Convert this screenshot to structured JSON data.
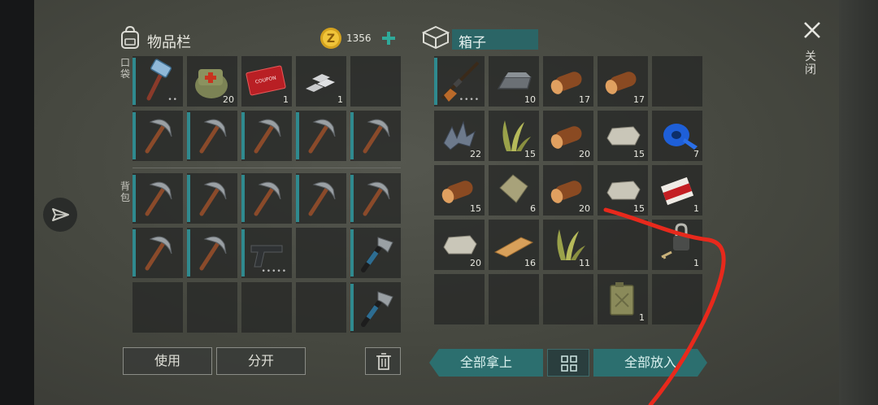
{
  "inventory": {
    "title": "物品栏",
    "pocket_label": "口袋",
    "backpack_label": "背包",
    "coins": "1356",
    "use_button": "使用",
    "split_button": "分开",
    "slots": [
      {
        "item": "hammer-icon",
        "count": "",
        "dots": "••",
        "indicator": true
      },
      {
        "item": "medkit-bag-icon",
        "count": "20",
        "dots": "",
        "indicator": false
      },
      {
        "item": "coupon-icon",
        "count": "1",
        "dots": "",
        "indicator": false,
        "coupon_text": "COMBAT TRADE COUPON"
      },
      {
        "item": "iron-ingots-icon",
        "count": "1",
        "dots": "",
        "indicator": false
      },
      {
        "item": "",
        "count": "",
        "dots": "",
        "indicator": false
      },
      {
        "item": "pickaxe-icon",
        "count": "",
        "dots": "",
        "indicator": true
      },
      {
        "item": "pickaxe-icon",
        "count": "",
        "dots": "",
        "indicator": true
      },
      {
        "item": "pickaxe-icon",
        "count": "",
        "dots": "",
        "indicator": true
      },
      {
        "item": "pickaxe-icon",
        "count": "",
        "dots": "",
        "indicator": true
      },
      {
        "item": "pickaxe-icon",
        "count": "",
        "dots": "",
        "indicator": true
      },
      {
        "item": "pickaxe-icon",
        "count": "",
        "dots": "",
        "indicator": true
      },
      {
        "item": "pickaxe-icon",
        "count": "",
        "dots": "",
        "indicator": true
      },
      {
        "item": "pickaxe-icon",
        "count": "",
        "dots": "",
        "indicator": true
      },
      {
        "item": "pickaxe-icon",
        "count": "",
        "dots": "",
        "indicator": true
      },
      {
        "item": "pickaxe-icon",
        "count": "",
        "dots": "",
        "indicator": true
      },
      {
        "item": "pickaxe-icon",
        "count": "",
        "dots": "",
        "indicator": true
      },
      {
        "item": "pickaxe-icon",
        "count": "",
        "dots": "",
        "indicator": true
      },
      {
        "item": "pistol-icon",
        "count": "",
        "dots": "•••••",
        "indicator": true
      },
      {
        "item": "",
        "count": "",
        "dots": "",
        "indicator": false
      },
      {
        "item": "hatchet-icon",
        "count": "",
        "dots": "",
        "indicator": true
      },
      {
        "item": "",
        "count": "",
        "dots": "",
        "indicator": false
      },
      {
        "item": "",
        "count": "",
        "dots": "",
        "indicator": false
      },
      {
        "item": "",
        "count": "",
        "dots": "",
        "indicator": false
      },
      {
        "item": "",
        "count": "",
        "dots": "",
        "indicator": false
      },
      {
        "item": "hatchet-icon",
        "count": "",
        "dots": "",
        "indicator": true
      }
    ]
  },
  "box": {
    "title": "箱子",
    "take_all_button": "全部拿上",
    "put_all_button": "全部放入",
    "slots": [
      {
        "item": "rifle-icon",
        "count": "",
        "dots": "••••",
        "indicator": true
      },
      {
        "item": "iron-ingot-icon",
        "count": "10"
      },
      {
        "item": "wood-log-icon",
        "count": "17"
      },
      {
        "item": "wood-log-icon",
        "count": "17"
      },
      {
        "item": "",
        "count": ""
      },
      {
        "item": "metal-scrap-icon",
        "count": "22"
      },
      {
        "item": "plant-fiber-icon",
        "count": "15"
      },
      {
        "item": "wood-log-icon",
        "count": "20"
      },
      {
        "item": "stone-icon",
        "count": "15"
      },
      {
        "item": "duct-tape-icon",
        "count": "7"
      },
      {
        "item": "wood-log-icon",
        "count": "15"
      },
      {
        "item": "cloth-icon",
        "count": "6"
      },
      {
        "item": "wood-log-icon",
        "count": "20"
      },
      {
        "item": "stone-icon",
        "count": "15"
      },
      {
        "item": "cigarettes-icon",
        "count": "1"
      },
      {
        "item": "stone-icon",
        "count": "20"
      },
      {
        "item": "plank-icon",
        "count": "16"
      },
      {
        "item": "plant-fiber-icon",
        "count": "11"
      },
      {
        "item": "",
        "count": ""
      },
      {
        "item": "padlock-icon",
        "count": "1"
      },
      {
        "item": "",
        "count": ""
      },
      {
        "item": "",
        "count": ""
      },
      {
        "item": "",
        "count": ""
      },
      {
        "item": "jerrycan-icon",
        "count": "1"
      },
      {
        "item": "",
        "count": ""
      }
    ]
  },
  "close_label": "关闭",
  "colors": {
    "accent": "#2f8a8f",
    "button_teal": "#2c6f6f",
    "annotation": "#e8291c"
  }
}
